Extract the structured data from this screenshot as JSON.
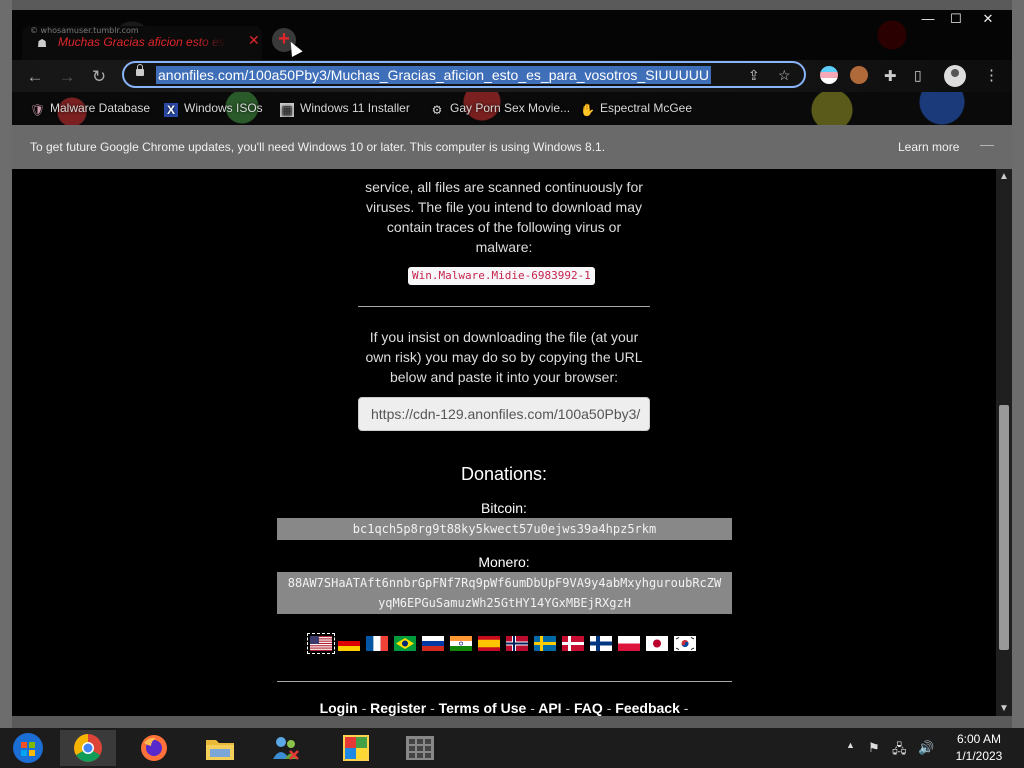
{
  "tab": {
    "site_label": "© whosamuser.tumblr.com",
    "title": "Muchas Gracias aficion esto es para vosotros SIUUUUU",
    "close_glyph": "✕"
  },
  "window_controls": {
    "minimize": "—",
    "maximize": "☐",
    "close": "✕"
  },
  "toolbar": {
    "back": "←",
    "forward": "→",
    "reload": "↻",
    "url": "anonfiles.com/100a50Pby3/Muchas_Gracias_aficion_esto_es_para_vosotros_SIUUUUU"
  },
  "bookmarks": [
    {
      "label": "Malware Database",
      "icon": "shield-icon"
    },
    {
      "label": "Windows ISOs",
      "icon": "x-icon"
    },
    {
      "label": "Windows 11 Installer",
      "icon": "installer-icon"
    },
    {
      "label": "Gay Porn Sex Movie...",
      "icon": "gear-icon"
    },
    {
      "label": "Espectral McGee",
      "icon": "hand-icon"
    }
  ],
  "infobar": {
    "message": "To get future Google Chrome updates, you'll need Windows 10 or later. This computer is using Windows 8.1.",
    "link": "Learn more"
  },
  "page": {
    "intro_lines": [
      "service, all files are scanned continuously for",
      "viruses. The file you intend to download may",
      "contain traces of the following virus or",
      "malware:"
    ],
    "virus_name": "Win.Malware.Midie-6983992-1",
    "insist_lines": [
      "If you insist on downloading the file (at your",
      "own risk) you may do so by copying the URL",
      "below and paste it into your browser:"
    ],
    "download_url": "https://cdn-129.anonfiles.com/100a50Pby3/",
    "donations_title": "Donations:",
    "bitcoin_label": "Bitcoin:",
    "bitcoin_address": "bc1qch5p8rg9t88ky5kwect57u0ejws39a4hpz5rkm",
    "monero_label": "Monero:",
    "monero_address": "88AW7SHaATAft6nnbrGpFNf7Rq9pWf6umDbUpF9VA9y4abMxyhguroubRcZWyqM6EPGuSamuzWh25GtHY14YGxMBEjRXgzH",
    "footer_links": [
      "Login",
      "Register",
      "Terms of Use",
      "API",
      "FAQ",
      "Feedback"
    ],
    "footer_sep": "-"
  },
  "flags": [
    "us",
    "de",
    "fr",
    "br",
    "ru",
    "in",
    "es",
    "no",
    "se",
    "dk",
    "fi",
    "pl",
    "jp",
    "kr"
  ],
  "taskbar": {
    "time": "6:00 AM",
    "date": "1/1/2023"
  }
}
